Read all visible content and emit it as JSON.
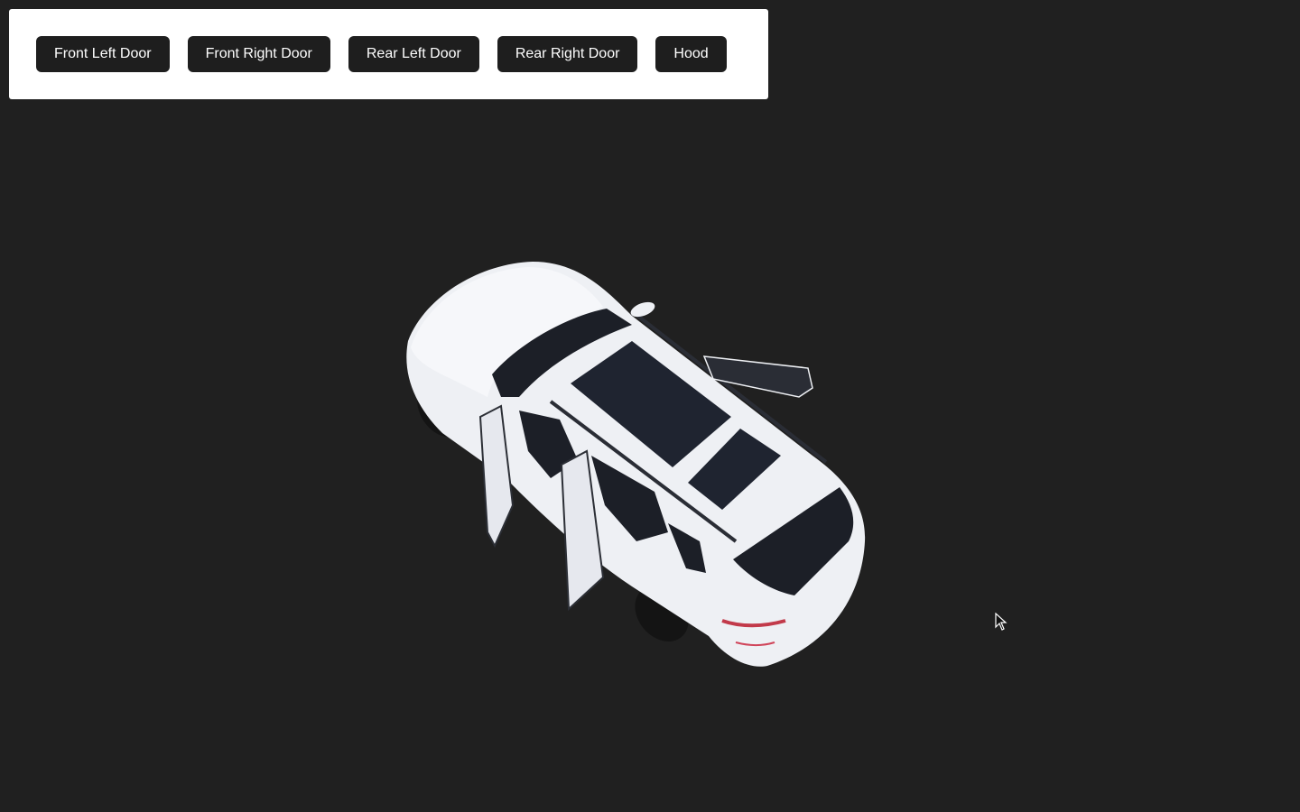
{
  "controls": {
    "buttons": [
      {
        "label": "Front Left Door"
      },
      {
        "label": "Front Right Door"
      },
      {
        "label": "Rear Left Door"
      },
      {
        "label": "Rear Right Door"
      },
      {
        "label": "Hood"
      }
    ]
  },
  "scene": {
    "background_color": "#202020",
    "model": "white-suv-3d-model",
    "body_color": "#eef0f4",
    "glass_color": "#1c1f27",
    "open_parts": [
      "front-left-door",
      "front-right-door",
      "rear-left-door"
    ]
  },
  "cursor_icon": "arrow-pointer-icon"
}
